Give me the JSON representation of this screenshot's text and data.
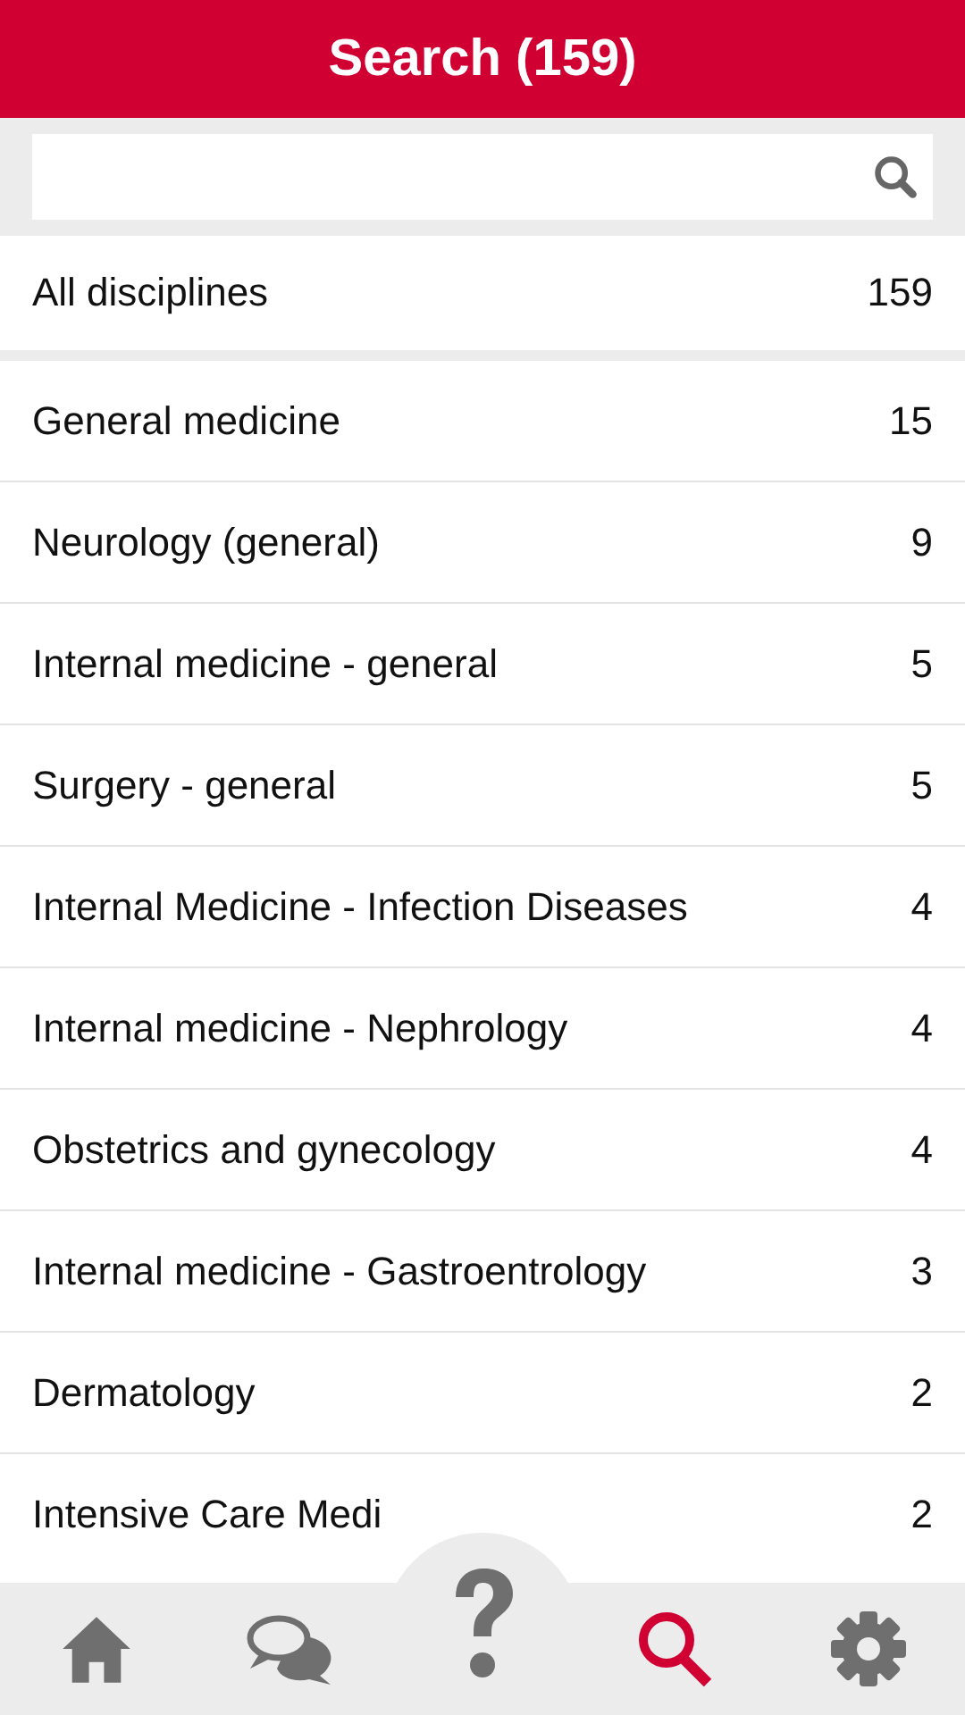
{
  "header": {
    "title": "Search (159)"
  },
  "all_row": {
    "label": "All disciplines",
    "count": "159"
  },
  "disciplines": [
    {
      "label": "General medicine",
      "count": "15"
    },
    {
      "label": "Neurology (general)",
      "count": "9"
    },
    {
      "label": "Internal medicine - general",
      "count": "5"
    },
    {
      "label": "Surgery - general",
      "count": "5"
    },
    {
      "label": "Internal Medicine - Infection Diseases",
      "count": "4"
    },
    {
      "label": "Internal medicine - Nephrology",
      "count": "4"
    },
    {
      "label": "Obstetrics and gynecology",
      "count": "4"
    },
    {
      "label": "Internal medicine - Gastroentrology",
      "count": "3"
    },
    {
      "label": "Dermatology",
      "count": "2"
    },
    {
      "label": "Intensive Care Medi",
      "count": "2"
    }
  ],
  "nav": [
    {
      "kind": "home",
      "selected": false
    },
    {
      "kind": "chat",
      "selected": false
    },
    {
      "kind": "help",
      "selected": false
    },
    {
      "kind": "search",
      "selected": true
    },
    {
      "kind": "settings",
      "selected": false
    }
  ]
}
